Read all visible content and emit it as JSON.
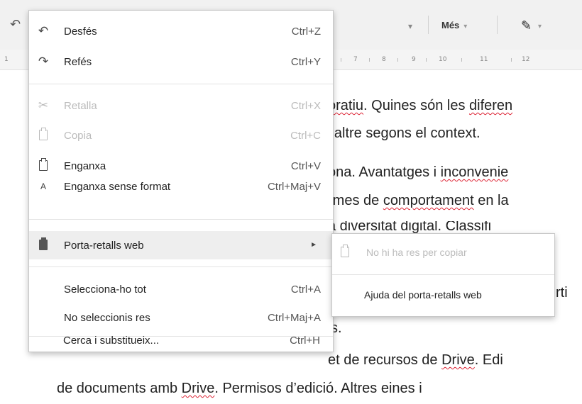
{
  "toolbar": {
    "undo_icon": "undo-icon",
    "dropdown_arrow": "▾",
    "more_label": "Més",
    "more_arrow": "▾",
    "pencil_icon": "pencil-icon",
    "pencil_arrow": "▾"
  },
  "ruler": {
    "start_label": "1",
    "numbers": [
      "7",
      "8",
      "9",
      "10",
      "11",
      "12"
    ]
  },
  "document": {
    "lines": [
      {
        "pre": "",
        "sq": "oratiu",
        "post": ". Quines són les ",
        "sq2": "diferen",
        "post2": ""
      },
      {
        "pre": "l’altre segons el context.",
        "sq": "",
        "post": "",
        "sq2": "",
        "post2": ""
      },
      {
        "pre": "ona. Avantatges i ",
        "sq": "inconvenie",
        "post": "",
        "sq2": "",
        "post2": ""
      },
      {
        "pre": "rmes de ",
        "sq": "comportament",
        "post": " en la",
        "sq2": "",
        "post2": ""
      },
      {
        "pre": "a  diversitat  digital.  Classifi",
        "sq": "",
        "post": "",
        "sq2": "",
        "post2": ""
      },
      {
        "pre": "rti",
        "sq": "",
        "post": "",
        "sq2": "",
        "post2": ""
      },
      {
        "pre": "s.",
        "sq": "",
        "post": "",
        "sq2": "",
        "post2": ""
      },
      {
        "pre": "et de recursos de ",
        "sq": "Drive",
        "post": ". Edi",
        "sq2": "",
        "post2": ""
      },
      {
        "pre": "de documents amb ",
        "sq": "Drive",
        "post": ". Permisos d’edició. Altres eines i",
        "sq2": "",
        "post2": ""
      }
    ]
  },
  "menu": {
    "items": [
      {
        "label": "Desfés",
        "shortcut": "Ctrl+Z",
        "icon": "undo-icon",
        "glyph": "↶",
        "disabled": false
      },
      {
        "label": "Refés",
        "shortcut": "Ctrl+Y",
        "icon": "redo-icon",
        "glyph": "↷",
        "disabled": false
      },
      {
        "label": "Retalla",
        "shortcut": "Ctrl+X",
        "icon": "scissors-icon",
        "glyph": "✂",
        "disabled": true
      },
      {
        "label": "Copia",
        "shortcut": "Ctrl+C",
        "icon": "copy-icon",
        "glyph": "",
        "disabled": true
      },
      {
        "label": "Enganxa",
        "shortcut": "Ctrl+V",
        "icon": "paste-icon",
        "glyph": "",
        "disabled": false
      },
      {
        "label": "Enganxa sense format",
        "shortcut": "Ctrl+Maj+V",
        "icon": "paste-plain-icon",
        "glyph": "A",
        "disabled": false
      },
      {
        "label": "Porta-retalls web",
        "shortcut": "",
        "icon": "web-clipboard-icon",
        "glyph": "",
        "disabled": false,
        "has_submenu": true,
        "submenu_arrow": "►"
      },
      {
        "label": "Selecciona-ho tot",
        "shortcut": "Ctrl+A",
        "icon": "",
        "glyph": "",
        "disabled": false
      },
      {
        "label": "No seleccionis res",
        "shortcut": "Ctrl+Maj+A",
        "icon": "",
        "glyph": "",
        "disabled": false
      },
      {
        "label": "Cerca i substitueix...",
        "shortcut": "Ctrl+H",
        "icon": "",
        "glyph": "",
        "disabled": false
      }
    ]
  },
  "submenu": {
    "items": [
      {
        "label": "No hi ha res per copiar",
        "icon": "clipboard-icon",
        "disabled": true
      },
      {
        "label": "Ajuda del porta-retalls web",
        "icon": "",
        "disabled": false
      }
    ]
  }
}
